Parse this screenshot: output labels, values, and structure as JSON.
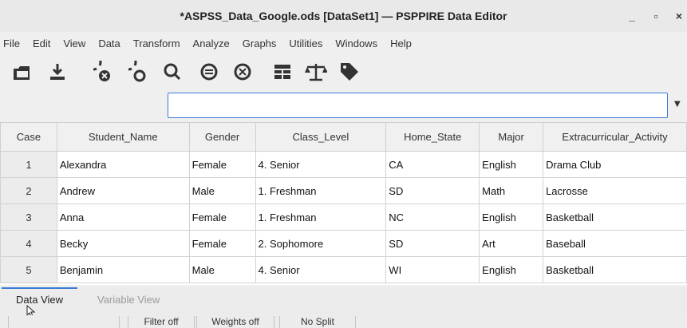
{
  "window": {
    "title": "*ASPSS_Data_Google.ods [DataSet1] — PSPPIRE Data Editor",
    "minimize": "_",
    "maximize": "▫",
    "close": "×"
  },
  "menu": [
    "File",
    "Edit",
    "View",
    "Data",
    "Transform",
    "Analyze",
    "Graphs",
    "Utilities",
    "Windows",
    "Help"
  ],
  "toolbar": {
    "icons": [
      "open-file-icon",
      "save-icon",
      "goto-case-icon",
      "goto-variable-icon",
      "find-icon",
      "insert-case-icon",
      "insert-variable-icon",
      "split-file-icon",
      "weight-cases-icon",
      "value-labels-icon"
    ]
  },
  "cell_input": {
    "value": ""
  },
  "grid": {
    "columns": [
      "Case",
      "Student_Name",
      "Gender",
      "Class_Level",
      "Home_State",
      "Major",
      "Extracurricular_Activity"
    ],
    "rows": [
      [
        "1",
        "Alexandra",
        "Female",
        "4. Senior",
        "CA",
        "English",
        "Drama Club"
      ],
      [
        "2",
        "Andrew",
        "Male",
        "1. Freshman",
        "SD",
        "Math",
        "Lacrosse"
      ],
      [
        "3",
        "Anna",
        "Female",
        "1. Freshman",
        "NC",
        "English",
        "Basketball"
      ],
      [
        "4",
        "Becky",
        "Female",
        "2. Sophomore",
        "SD",
        "Art",
        "Baseball"
      ],
      [
        "5",
        "Benjamin",
        "Male",
        "4. Senior",
        "WI",
        "English",
        "Basketball"
      ]
    ]
  },
  "tabs": {
    "data_view": "Data View",
    "variable_view": "Variable View"
  },
  "status": {
    "filter": "Filter off",
    "weights": "Weights off",
    "split": "No Split"
  },
  "colors": {
    "accent": "#3a7bd5"
  }
}
